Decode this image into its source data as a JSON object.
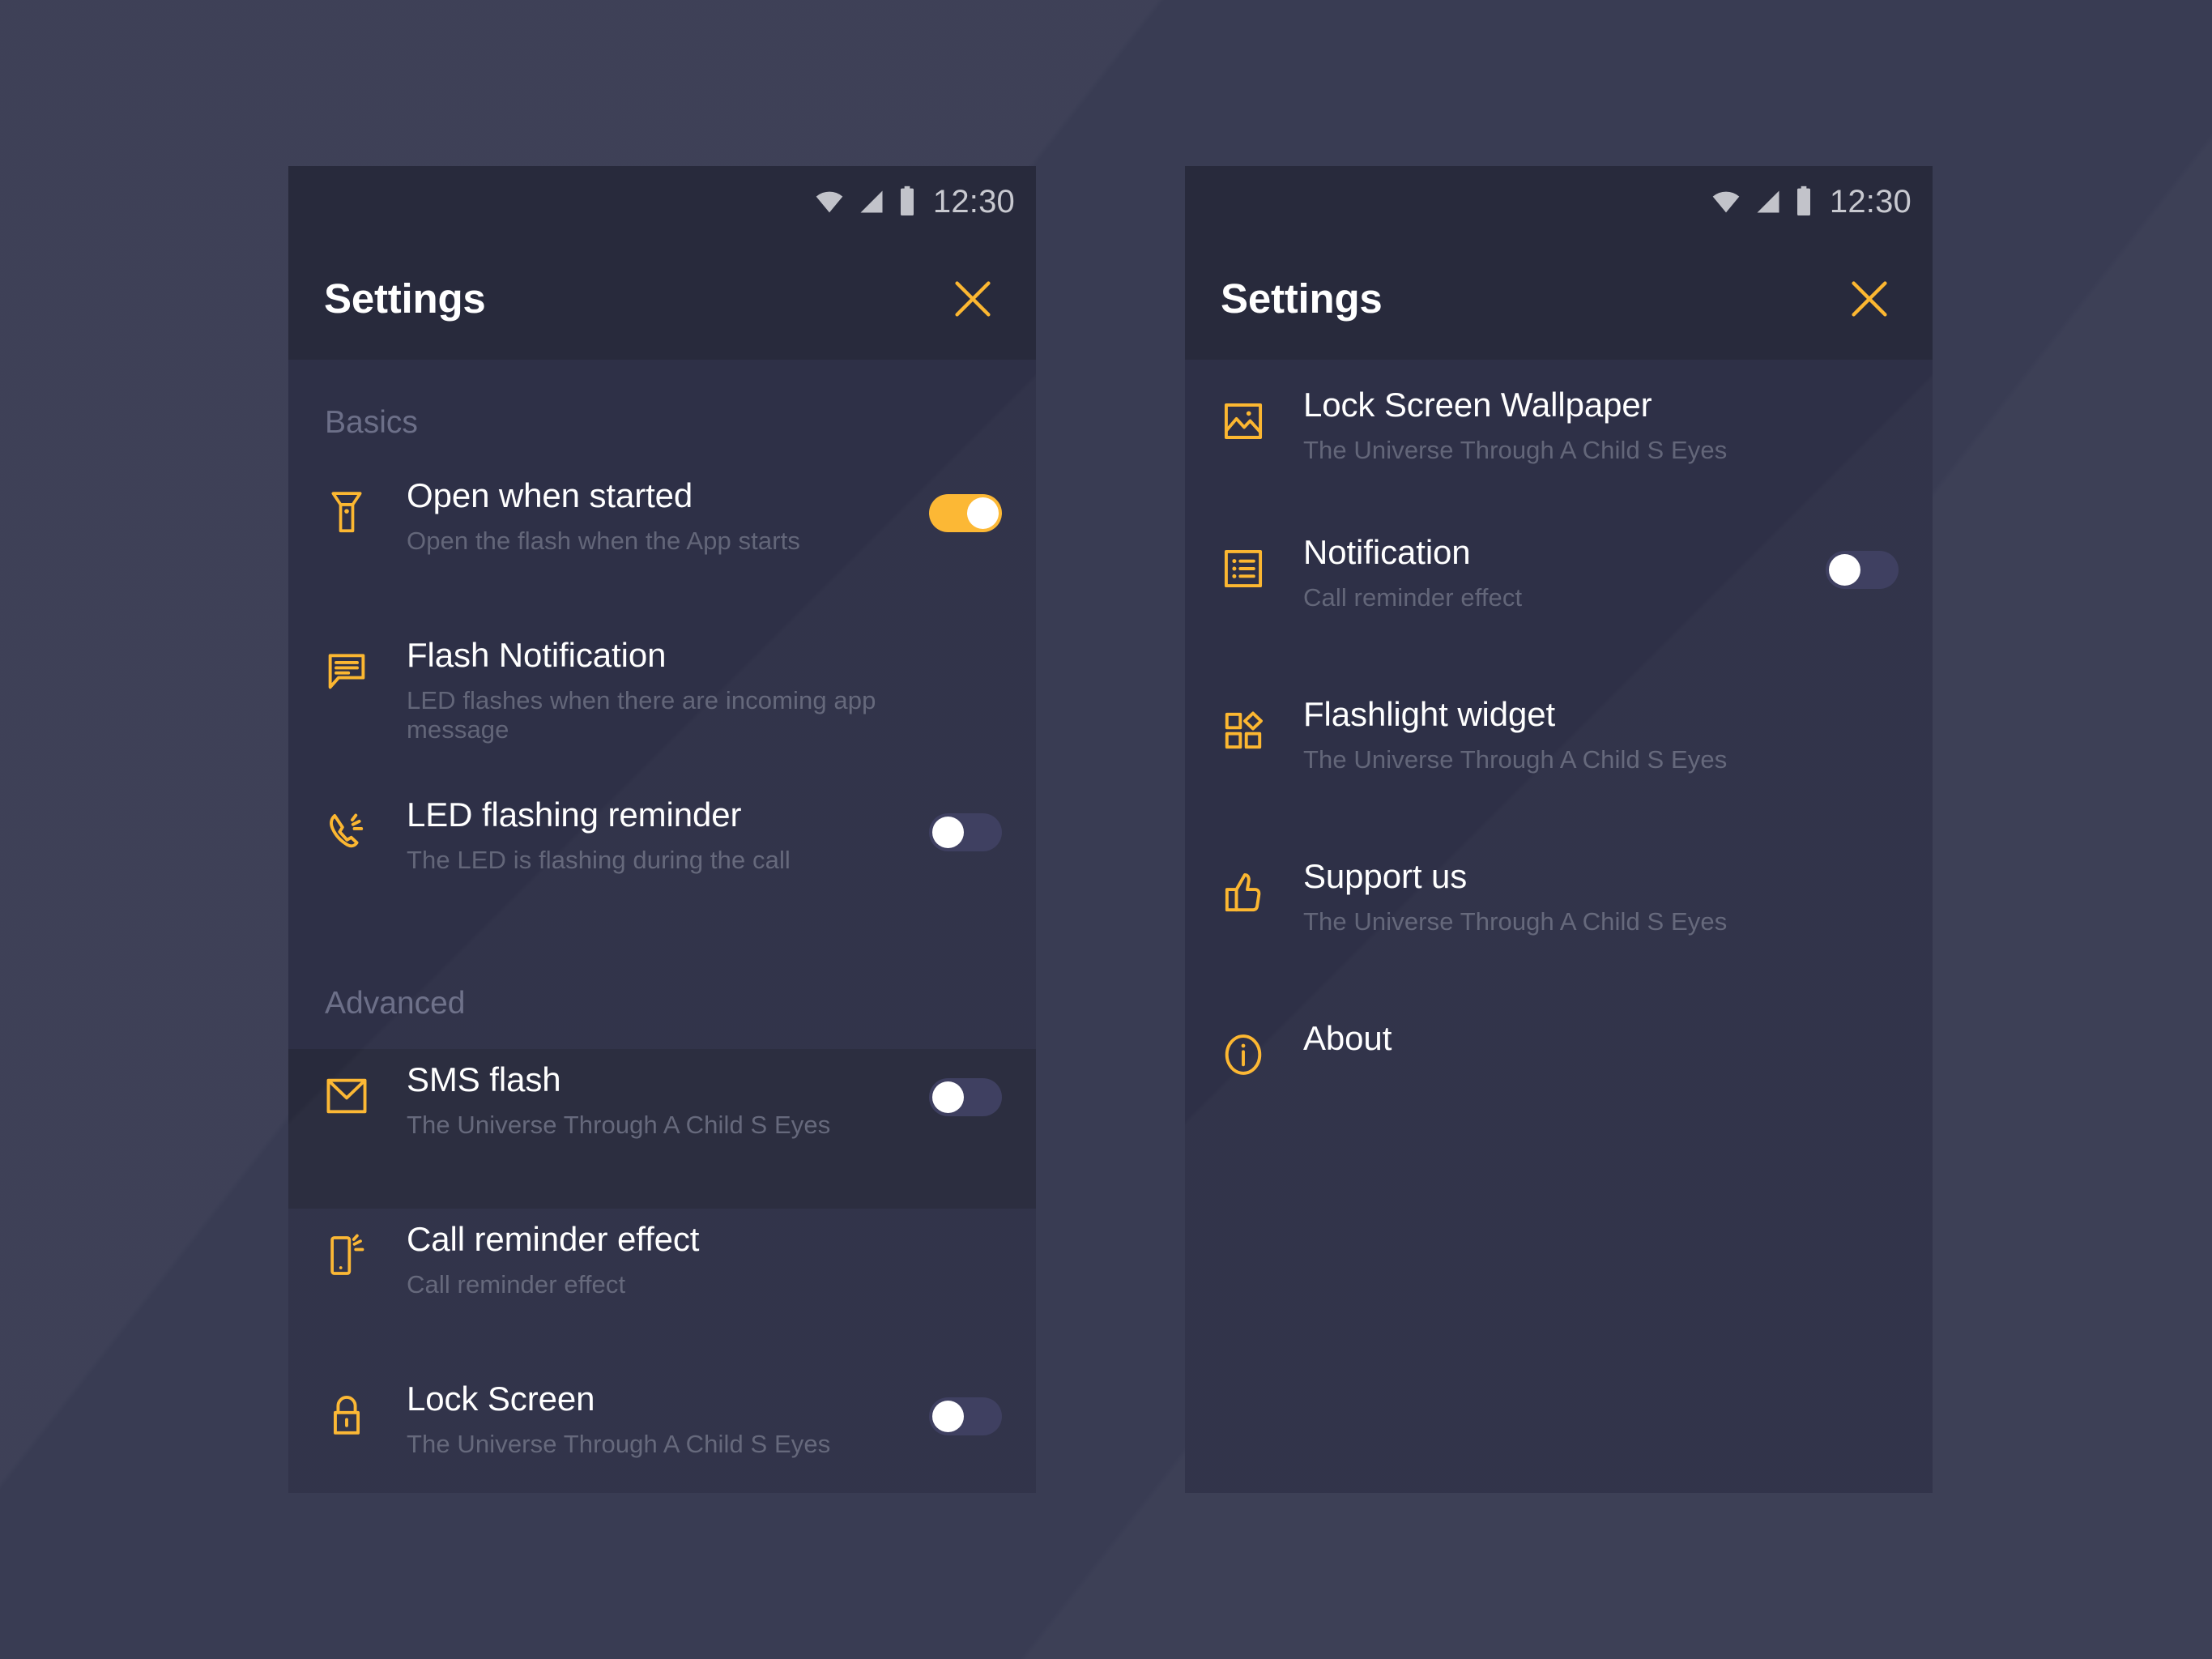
{
  "background_color": "#393c53",
  "accent_color": "#fcb731",
  "panel_color": "#2e3047",
  "panel_dark_color": "#282a3c",
  "status_bar": {
    "time": "12:30",
    "icons": [
      "wifi-icon",
      "signal-icon",
      "battery-icon"
    ]
  },
  "app_bar": {
    "title": "Settings",
    "close_label": "close-icon"
  },
  "left_panel": {
    "sections": [
      {
        "label": "Basics",
        "items": [
          {
            "icon": "flashlight-icon",
            "title": "Open when started",
            "subtitle": "Open the flash when the App starts",
            "toggle": "on",
            "highlight": false
          },
          {
            "icon": "message-icon",
            "title": "Flash Notification",
            "subtitle": "LED flashes when there are incoming app message",
            "toggle": "none",
            "highlight": false
          },
          {
            "icon": "call-ring-icon",
            "title": "LED flashing reminder",
            "subtitle": "The LED is flashing during the call",
            "toggle": "off",
            "highlight": false
          }
        ]
      },
      {
        "label": "Advanced",
        "items": [
          {
            "icon": "envelope-icon",
            "title": "SMS flash",
            "subtitle": "The Universe Through A Child S Eyes",
            "toggle": "off",
            "highlight": true
          },
          {
            "icon": "phone-vibrate-icon",
            "title": "Call reminder effect",
            "subtitle": "Call reminder effect",
            "toggle": "none",
            "highlight": false
          },
          {
            "icon": "lock-icon",
            "title": "Lock Screen",
            "subtitle": "The Universe Through A Child S Eyes",
            "toggle": "off",
            "highlight": false
          }
        ]
      }
    ]
  },
  "right_panel": {
    "items": [
      {
        "icon": "image-icon",
        "title": "Lock Screen Wallpaper",
        "subtitle": "The Universe Through A Child S Eyes",
        "toggle": "none"
      },
      {
        "icon": "list-icon",
        "title": "Notification",
        "subtitle": "Call reminder effect",
        "toggle": "off"
      },
      {
        "icon": "widget-icon",
        "title": "Flashlight widget",
        "subtitle": "The Universe Through A Child S Eyes",
        "toggle": "none"
      },
      {
        "icon": "thumbs-up-icon",
        "title": "Support us",
        "subtitle": "The Universe Through A Child S Eyes",
        "toggle": "none"
      },
      {
        "icon": "info-icon",
        "title": "About",
        "subtitle": "",
        "toggle": "none"
      }
    ]
  }
}
